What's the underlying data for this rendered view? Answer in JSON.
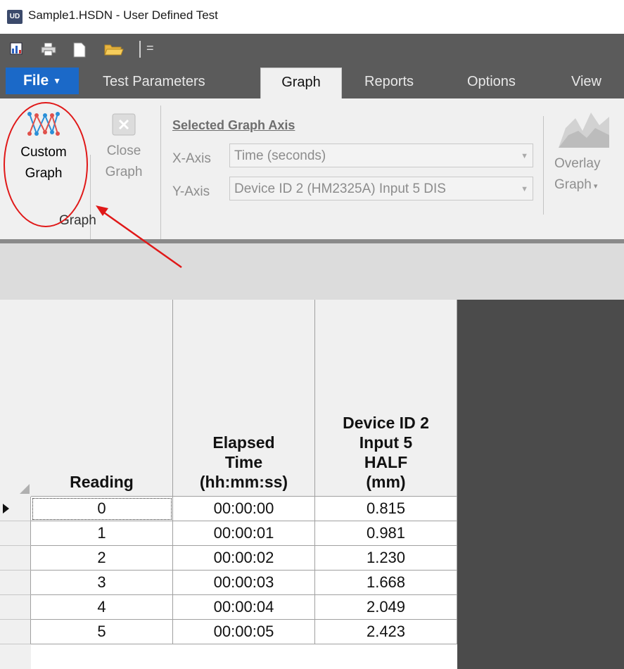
{
  "window": {
    "title": "Sample1.HSDN - User Defined Test",
    "icon_text": "UD"
  },
  "tabs": {
    "file": "File",
    "items": [
      "Test Parameters",
      "Graph",
      "Reports",
      "Options",
      "View"
    ],
    "active": "Graph"
  },
  "ribbon": {
    "custom_graph": {
      "line1": "Custom",
      "line2": "Graph"
    },
    "close_graph": {
      "line1": "Close",
      "line2": "Graph"
    },
    "group_label": "Graph",
    "axis": {
      "title": "Selected Graph Axis",
      "x_label": "X-Axis",
      "x_value": "Time (seconds)",
      "y_label": "Y-Axis",
      "y_value": "Device ID 2 (HM2325A) Input 5 DIS"
    },
    "overlay_graph": {
      "line1": "Overlay",
      "line2": "Graph"
    }
  },
  "table": {
    "headers": {
      "reading": [
        "Reading"
      ],
      "elapsed": [
        "Elapsed",
        "Time",
        "(hh:mm:ss)"
      ],
      "device": [
        "Device ID 2",
        "Input 5",
        "HALF",
        "(mm)"
      ]
    },
    "rows": [
      {
        "reading": "0",
        "time": "00:00:00",
        "value": "0.815"
      },
      {
        "reading": "1",
        "time": "00:00:01",
        "value": "0.981"
      },
      {
        "reading": "2",
        "time": "00:00:02",
        "value": "1.230"
      },
      {
        "reading": "3",
        "time": "00:00:03",
        "value": "1.668"
      },
      {
        "reading": "4",
        "time": "00:00:04",
        "value": "2.049"
      },
      {
        "reading": "5",
        "time": "00:00:05",
        "value": "2.423"
      }
    ]
  },
  "colors": {
    "file_tab": "#1b69c8",
    "annotation": "#e01818",
    "dark_chrome": "#5b5b5b"
  }
}
